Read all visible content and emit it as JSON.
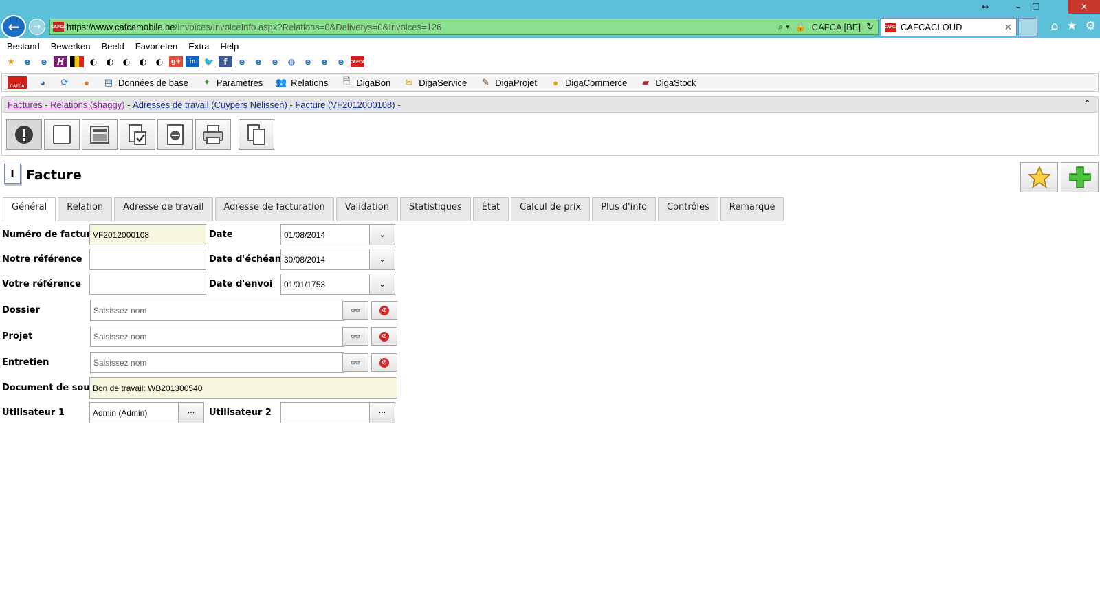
{
  "browser": {
    "url_domain": "https://www.cafcamobile.be",
    "url_path": "/Invoices/InvoiceInfo.aspx?Relations=0&Deliverys=0&Invoices=126",
    "site_label": "CAFCA [BE]",
    "tab_title": "CAFCACLOUD",
    "menu": [
      "Bestand",
      "Bewerken",
      "Beeld",
      "Favorieten",
      "Extra",
      "Help"
    ]
  },
  "app_toolbar": {
    "items": [
      {
        "label": "Données de base",
        "icon": "database-icon"
      },
      {
        "label": "Paramètres",
        "icon": "settings-icon"
      },
      {
        "label": "Relations",
        "icon": "relations-icon"
      },
      {
        "label": "DigaBon",
        "icon": "digabon-icon"
      },
      {
        "label": "DigaService",
        "icon": "digaservice-icon"
      },
      {
        "label": "DigaProjet",
        "icon": "digaprojet-icon"
      },
      {
        "label": "DigaCommerce",
        "icon": "digacommerce-icon"
      },
      {
        "label": "DigaStock",
        "icon": "digastock-icon"
      }
    ]
  },
  "breadcrumb": {
    "link": "Factures - Relations (shaggy)",
    "separator": " - ",
    "current": "Adresses de travail (Cuypers Nelissen) - Facture (VF2012000108) -"
  },
  "page": {
    "title": "Facture"
  },
  "tabs": [
    "Général",
    "Relation",
    "Adresse de travail",
    "Adresse de facturation",
    "Validation",
    "Statistiques",
    "État",
    "Calcul de prix",
    "Plus d'info",
    "Contrôles",
    "Remarque"
  ],
  "form": {
    "invoice_number_label": "Numéro de facture",
    "invoice_number": "VF2012000108",
    "date_label": "Date",
    "date": "01/08/2014",
    "our_ref_label": "Notre référence",
    "our_ref": "",
    "due_date_label": "Date d'échéance",
    "due_date": "30/08/2014",
    "your_ref_label": "Votre référence",
    "your_ref": "",
    "send_date_label": "Date d'envoi",
    "send_date": "01/01/1753",
    "dossier_label": "Dossier",
    "projet_label": "Projet",
    "entretien_label": "Entretien",
    "name_placeholder": "Saisissez nom",
    "source_doc_label": "Document de source",
    "source_doc": "Bon de travail: WB201300540",
    "user1_label": "Utilisateur 1",
    "user1": "Admin (Admin)",
    "user2_label": "Utilisateur 2",
    "user2": "",
    "ellipsis": "···"
  }
}
